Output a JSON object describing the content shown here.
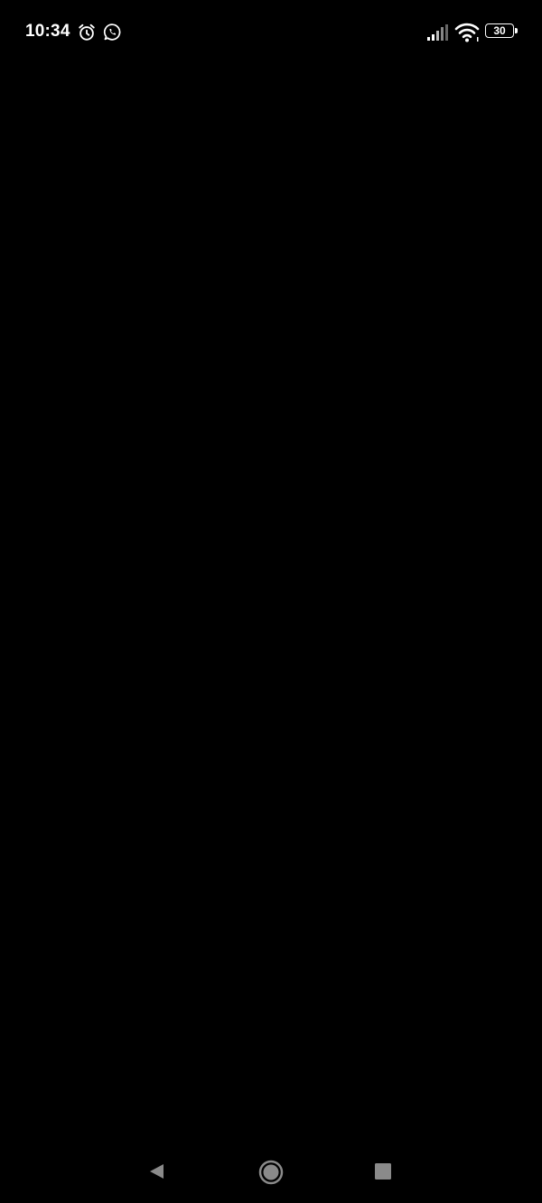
{
  "status_bar": {
    "time": "10:34",
    "battery_level": "30",
    "icons": [
      "alarm-icon",
      "whatsapp-icon",
      "signal-icon",
      "wifi-icon",
      "battery-icon"
    ]
  },
  "navigation_bar": {
    "icons": [
      "back-icon",
      "home-icon",
      "recents-icon"
    ]
  },
  "colors": {
    "background": "#000000",
    "foreground": "#ffffff",
    "nav_icon": "#8a8a8a"
  }
}
